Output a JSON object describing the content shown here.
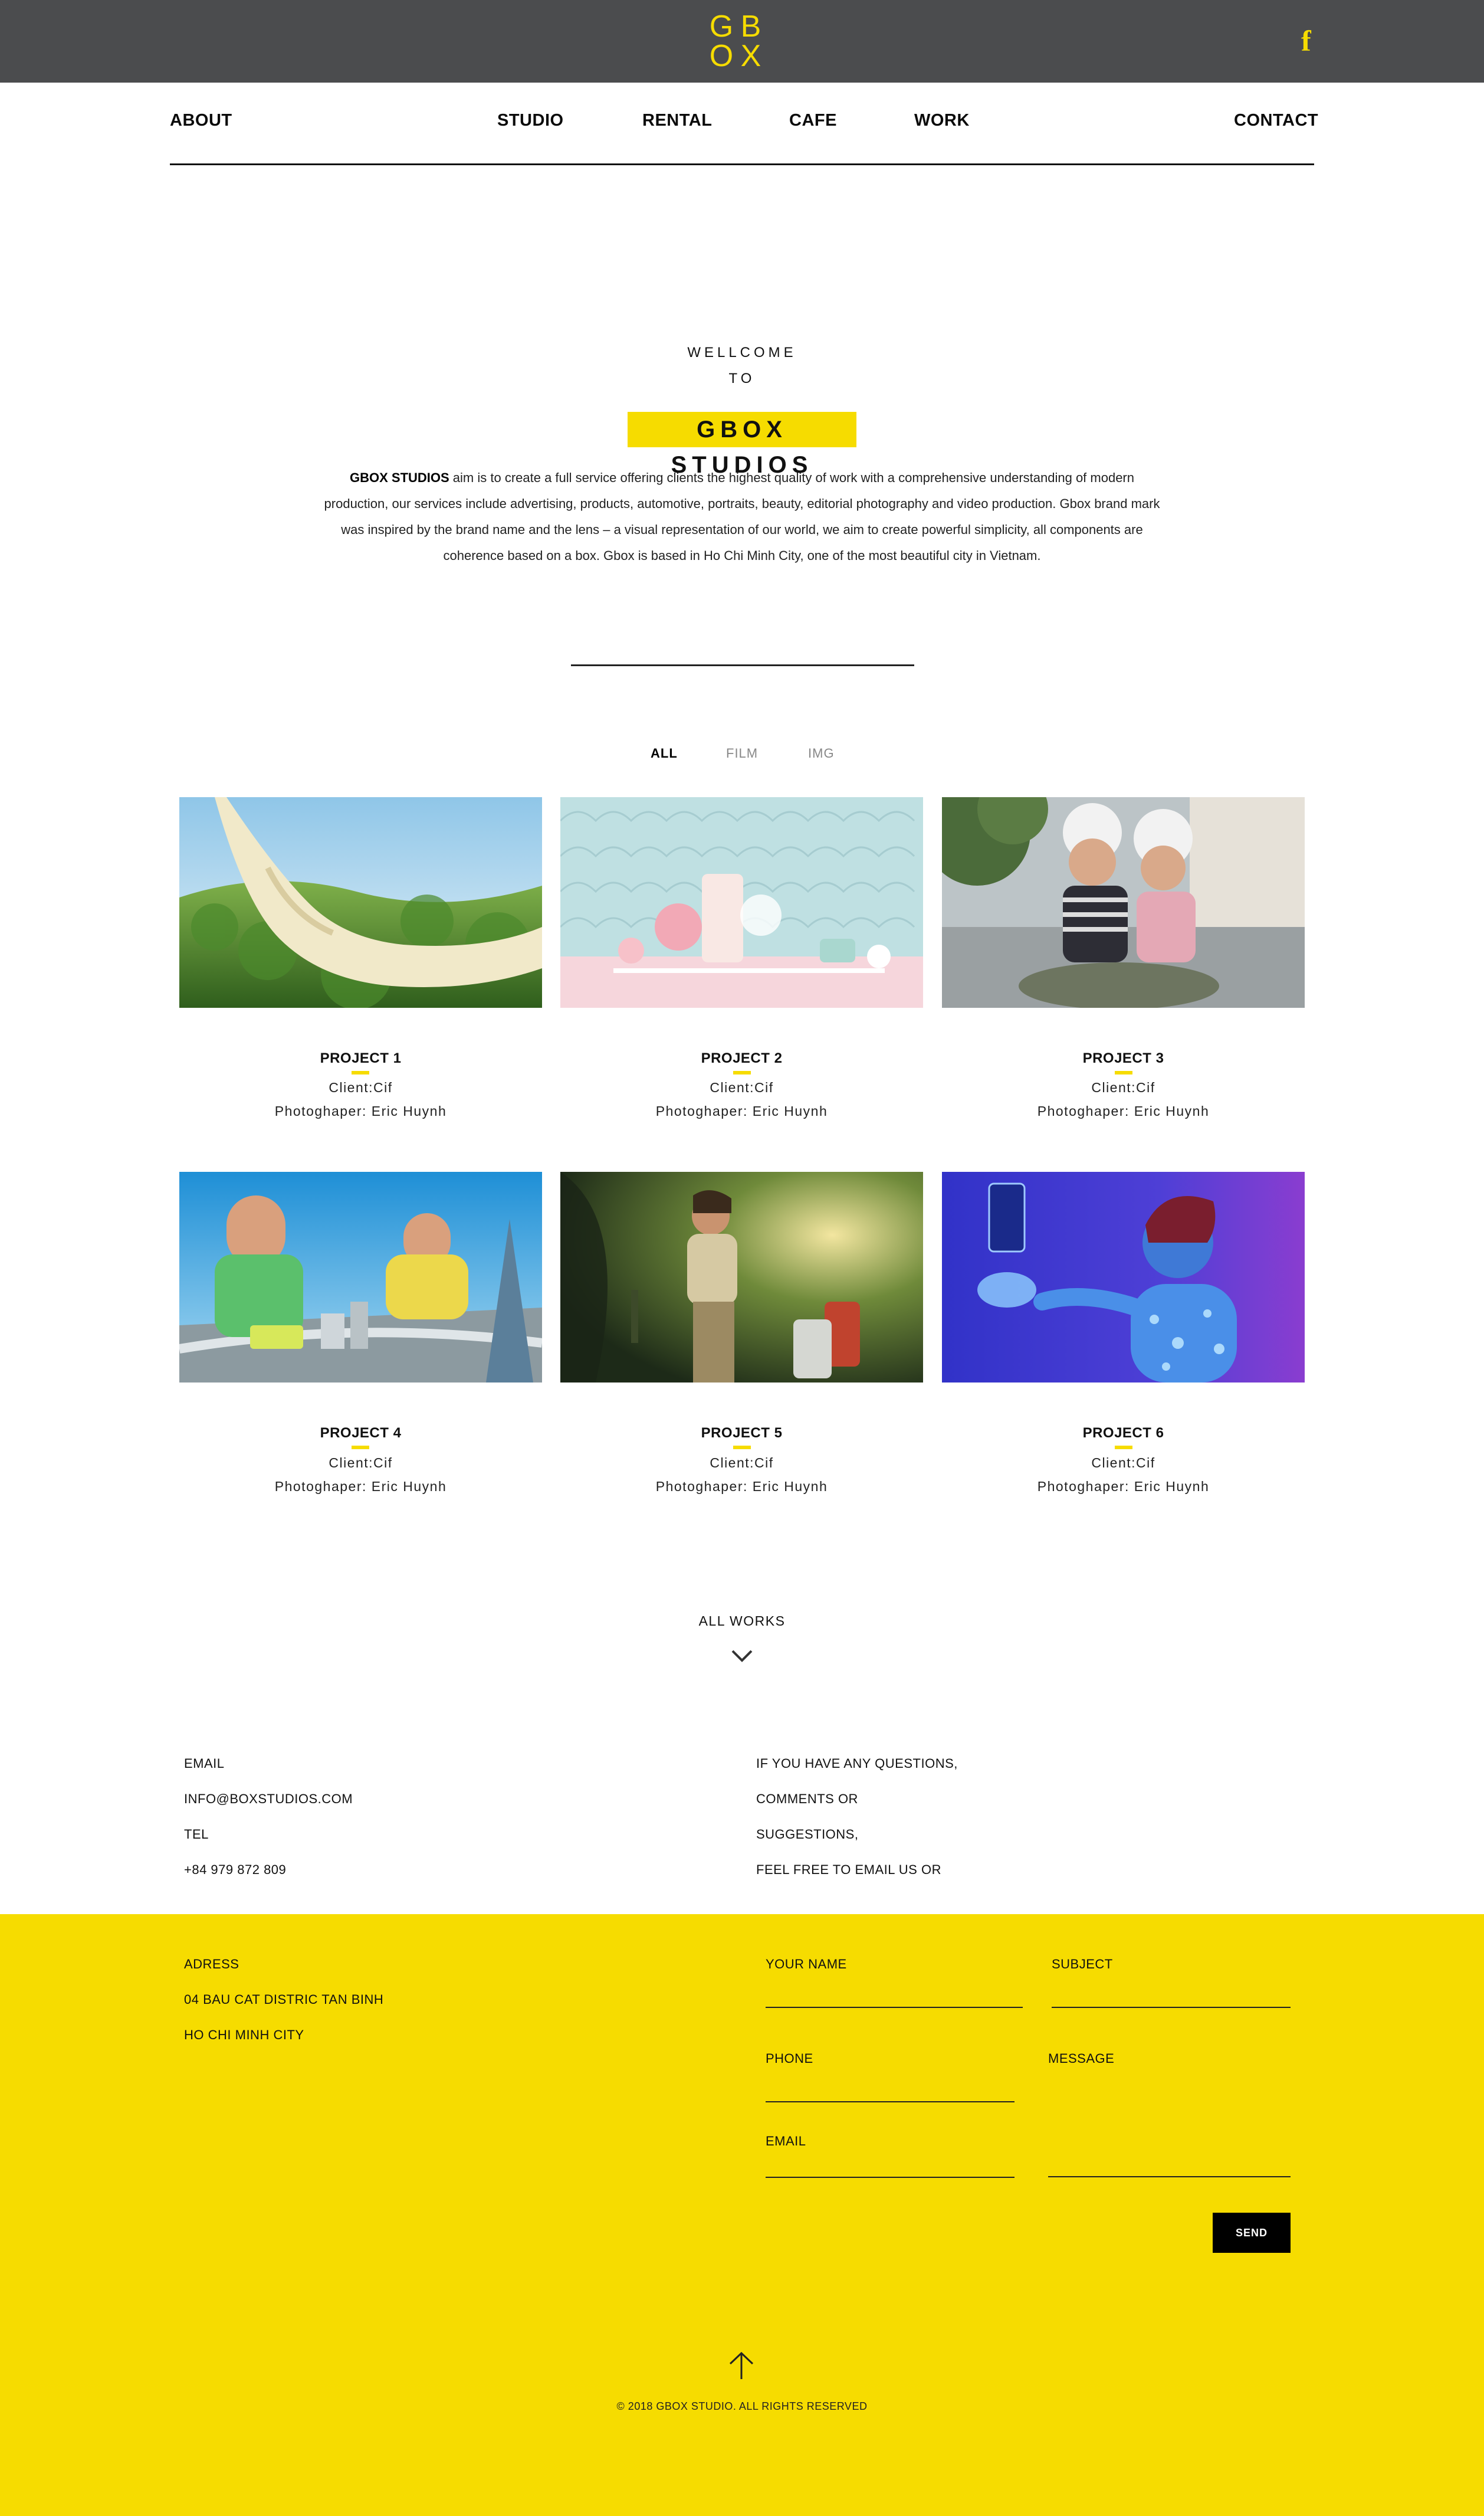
{
  "brand": {
    "logo_letters": [
      "G",
      "B",
      "O",
      "X"
    ],
    "facebook_icon": "f",
    "accent_color": "#f6dc00",
    "topbar_color": "#4b4c4e"
  },
  "nav": {
    "about": "ABOUT",
    "studio": "STUDIO",
    "rental": "RENTAL",
    "cafe": "CAFE",
    "work": "WORK",
    "contact": "CONTACT"
  },
  "intro": {
    "welcome": "WELLCOME",
    "to": "TO",
    "brand_name": "GBOX STUDIOS",
    "lead": "GBOX STUDIOS",
    "body": " aim is to create a full service offering clients the highest quality of work with a comprehensive understanding of modern production, our services include advertising, products, automotive, portraits, beauty, editorial photography and video production. Gbox brand mark was inspired by the brand name and the lens – a visual representation of our world, we aim to create powerful simplicity, all components are coherence based on a box. Gbox is based in Ho Chi Minh City, one of the most beautiful city in Vietnam."
  },
  "filters": {
    "all": "ALL",
    "film": "FILM",
    "img": "IMG",
    "active": "ALL"
  },
  "projects": [
    {
      "title": "PROJECT 1",
      "client": "Client:Cif",
      "photographer": "Photoghaper: Eric Huynh"
    },
    {
      "title": "PROJECT 2",
      "client": "Client:Cif",
      "photographer": "Photoghaper: Eric Huynh"
    },
    {
      "title": "PROJECT 3",
      "client": "Client:Cif",
      "photographer": "Photoghaper: Eric Huynh"
    },
    {
      "title": "PROJECT 4",
      "client": "Client:Cif",
      "photographer": "Photoghaper: Eric Huynh"
    },
    {
      "title": "PROJECT 5",
      "client": "Client:Cif",
      "photographer": "Photoghaper: Eric Huynh"
    },
    {
      "title": "PROJECT 6",
      "client": "Client:Cif",
      "photographer": "Photoghaper: Eric Huynh"
    }
  ],
  "all_works": "ALL WORKS",
  "contact_info": {
    "email_label": "EMAIL",
    "email": "INFO@BOXSTUDIOS.COM",
    "tel_label": "TEL",
    "tel": "+84 979 872 809",
    "address_label": "ADRESS",
    "address_line1": "04 BAU CAT DISTRIC TAN BINH",
    "address_line2": "HO CHI MINH CITY"
  },
  "questions": [
    "IF YOU HAVE ANY QUESTIONS,",
    "COMMENTS OR",
    "SUGGESTIONS,",
    "FEEL FREE TO EMAIL US OR"
  ],
  "form": {
    "name": "YOUR NAME",
    "subject": "SUBJECT",
    "phone": "PHONE",
    "message": "MESSAGE",
    "email": "EMAIL",
    "send": "SEND"
  },
  "footer": {
    "copyright": "© 2018 GBOX STUDIO. ALL RIGHTS RESERVED"
  }
}
